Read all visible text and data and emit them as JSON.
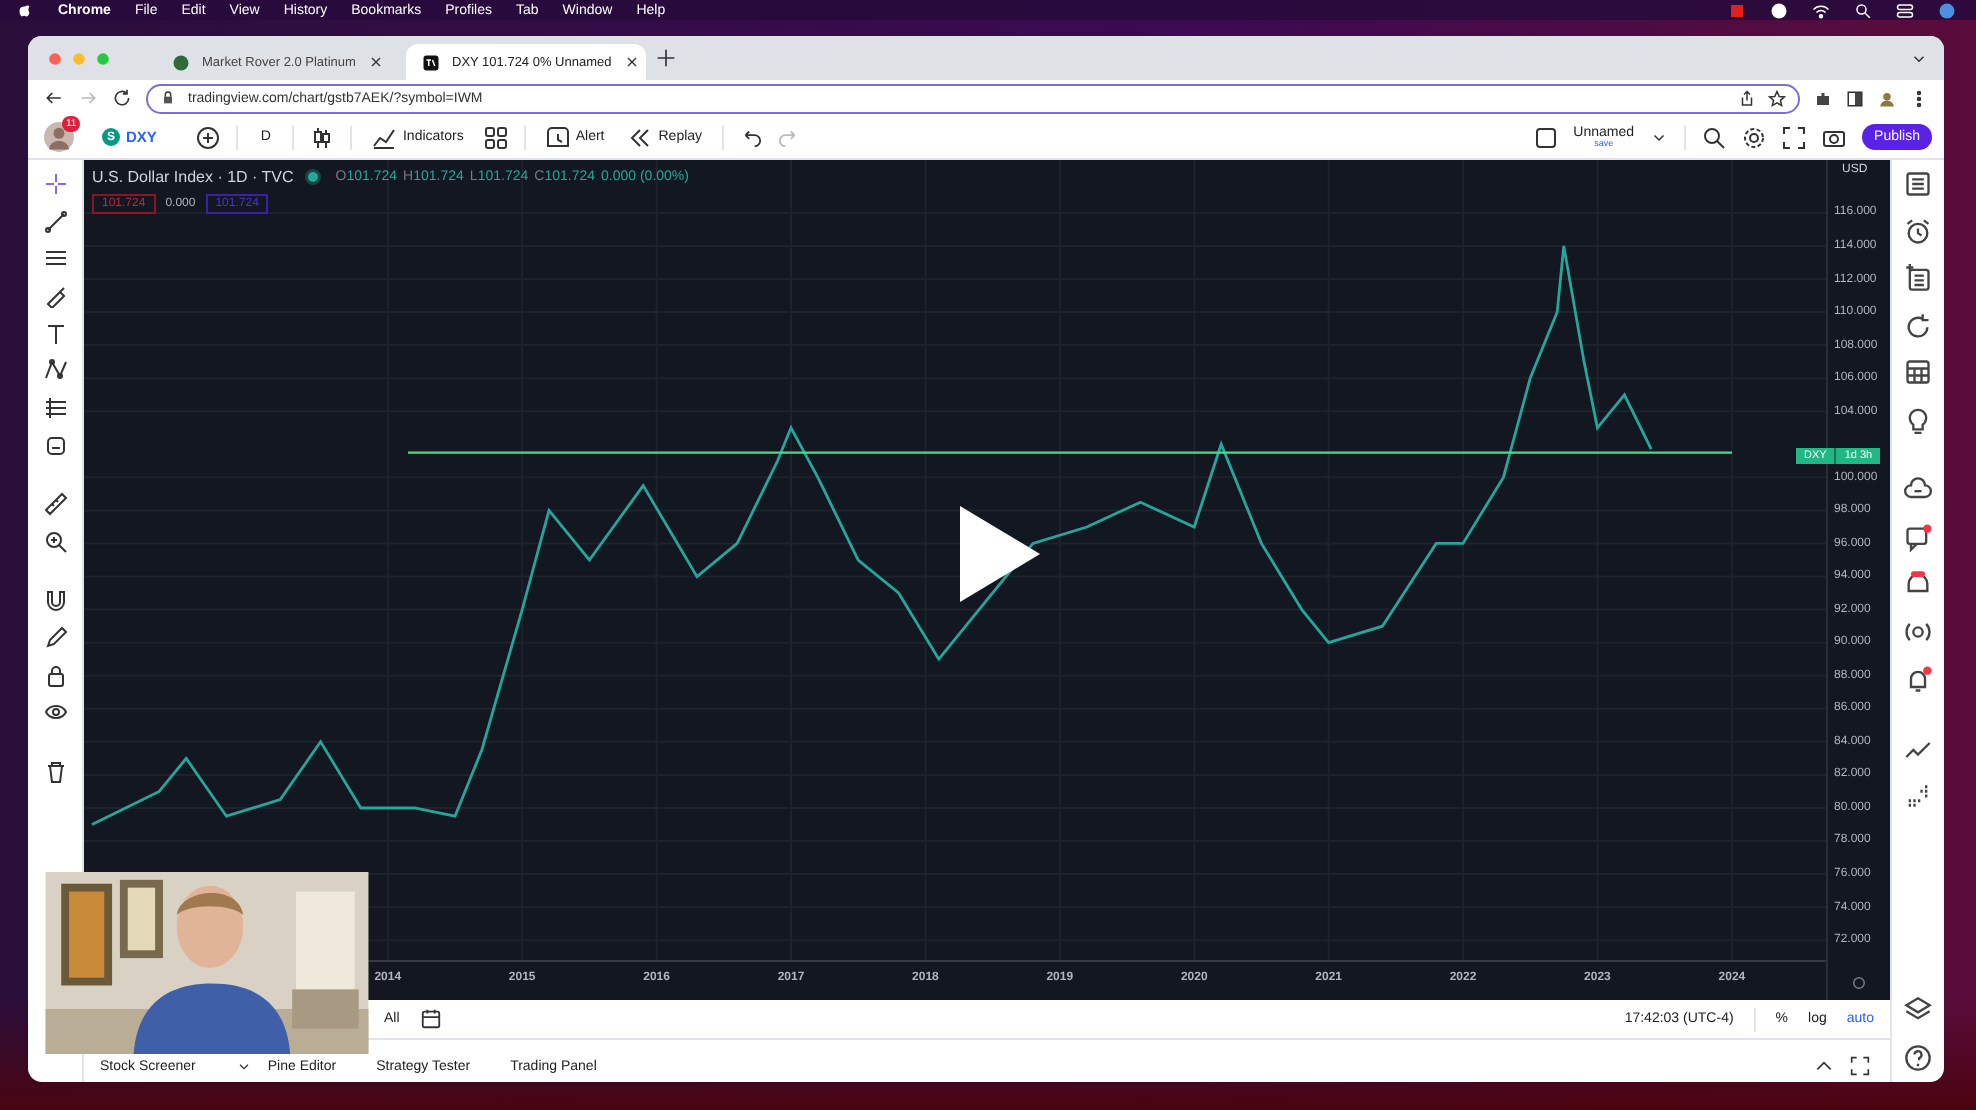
{
  "menu_bar": {
    "app": "Chrome",
    "items": [
      "File",
      "Edit",
      "View",
      "History",
      "Bookmarks",
      "Profiles",
      "Tab",
      "Window",
      "Help"
    ]
  },
  "browser": {
    "tabs": [
      {
        "title": "Market Rover 2.0 Platinum",
        "selected": false
      },
      {
        "title": "DXY 101.724 0% Unnamed",
        "selected": true
      }
    ],
    "url": "tradingview.com/chart/gstb7AEK/?symbol=IWM"
  },
  "toolbar": {
    "avatar_badge": "11",
    "symbol_icon": "S",
    "symbol": "DXY",
    "interval": "D",
    "buttons": [
      "Indicators",
      "Alert",
      "Replay"
    ],
    "layout_name": "Unnamed",
    "layout_status": "save",
    "publish": "Publish"
  },
  "chart": {
    "legend": {
      "title": "U.S. Dollar Index · 1D · TVC",
      "values": [
        {
          "label": "O",
          "value": "101.724"
        },
        {
          "label": "H",
          "value": "101.724"
        },
        {
          "label": "L",
          "value": "101.724"
        },
        {
          "label": "C",
          "value": "101.724"
        }
      ],
      "change": "0.000 (0.00%)",
      "sell": "101.724",
      "spread": "0.000",
      "buy": "101.724"
    },
    "currency": "USD",
    "price_tag": {
      "countdown": "1d 3h"
    },
    "chart_data": {
      "type": "line",
      "x": [
        2011.8,
        2012.3,
        2012.5,
        2012.8,
        2013.2,
        2013.5,
        2013.8,
        2014.15,
        2014.2,
        2014.5,
        2014.7,
        2015.0,
        2015.2,
        2015.5,
        2015.9,
        2016.3,
        2016.6,
        2016.9,
        2017.0,
        2017.2,
        2017.5,
        2017.8,
        2018.1,
        2018.8,
        2019.2,
        2019.6,
        2020.0,
        2020.2,
        2020.5,
        2020.8,
        2021.0,
        2021.4,
        2021.8,
        2022.0,
        2022.3,
        2022.5,
        2022.7,
        2022.75,
        2022.9,
        2023.0,
        2023.2,
        2023.4,
        2024
      ],
      "series": [
        {
          "name": "DXY",
          "color": "#26a69a",
          "values": [
            79,
            81,
            83,
            79.5,
            80.5,
            84,
            80,
            80,
            80,
            79.5,
            83.5,
            92,
            98,
            95,
            99.5,
            94,
            96,
            101,
            103,
            100,
            95,
            93,
            89,
            96,
            97,
            98.5,
            97,
            102,
            96,
            92,
            90,
            91,
            96,
            96,
            100,
            106,
            110,
            114,
            107,
            103,
            105,
            101.7,
            null
          ]
        },
        {
          "color": "#4cd98a",
          "values": [
            null,
            null,
            null,
            null,
            null,
            null,
            null,
            101.5,
            null,
            null,
            null,
            null,
            null,
            null,
            null,
            null,
            null,
            null,
            null,
            null,
            null,
            null,
            null,
            null,
            null,
            null,
            null,
            null,
            null,
            null,
            null,
            null,
            null,
            null,
            null,
            null,
            null,
            null,
            null,
            null,
            null,
            null,
            101.5
          ]
        }
      ],
      "xlim": [
        2011.74,
        2024.7
      ],
      "ylim": [
        68.38,
        119.2
      ],
      "xticks": [
        2014,
        2015,
        2016,
        2017,
        2018,
        2019,
        2020,
        2021,
        2022,
        2023,
        2024
      ],
      "yticks": [
        {
          "value": 72,
          "label": "72.000"
        },
        {
          "value": 74,
          "label": "74.000"
        },
        {
          "value": 76,
          "label": "76.000"
        },
        {
          "value": 78,
          "label": "78.000"
        },
        {
          "value": 80,
          "label": "80.000"
        },
        {
          "value": 82,
          "label": "82.000"
        },
        {
          "value": 84,
          "label": "84.000"
        },
        {
          "value": 86,
          "label": "86.000"
        },
        {
          "value": 88,
          "label": "88.000"
        },
        {
          "value": 90,
          "label": "90.000"
        },
        {
          "value": 92,
          "label": "92.000"
        },
        {
          "value": 94,
          "label": "94.000"
        },
        {
          "value": 96,
          "label": "96.000"
        },
        {
          "value": 98,
          "label": "98.000"
        },
        {
          "value": 100,
          "label": "100.000"
        },
        {
          "value": 104,
          "label": "104.000"
        },
        {
          "value": 106,
          "label": "106.000"
        },
        {
          "value": 108,
          "label": "108.000"
        },
        {
          "value": 110,
          "label": "110.000"
        },
        {
          "value": 112,
          "label": "112.000"
        },
        {
          "value": 114,
          "label": "114.000"
        },
        {
          "value": 116,
          "label": "116.000"
        }
      ],
      "grid": true
    }
  },
  "bottom_bar": {
    "range": "All",
    "time": "17:42:03 (UTC-4)",
    "toggles": [
      {
        "label": "%",
        "selected": false
      },
      {
        "label": "log",
        "selected": false
      },
      {
        "label": "auto",
        "selected": true
      }
    ]
  },
  "panel_tabs": [
    "Stock Screener",
    "Pine Editor",
    "Strategy Tester",
    "Trading Panel"
  ],
  "video": {
    "paused": true
  }
}
